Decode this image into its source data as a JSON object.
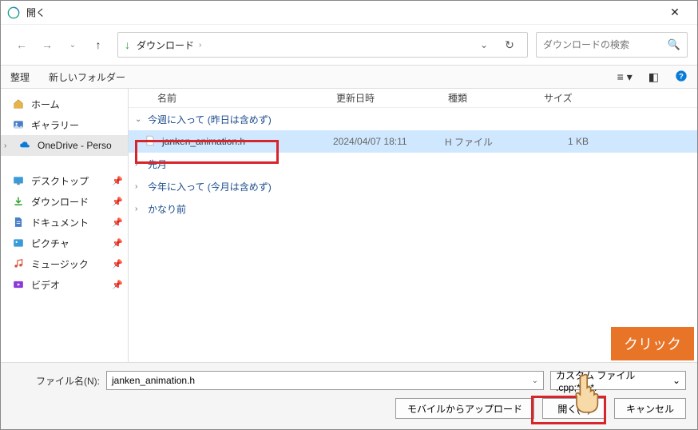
{
  "titlebar": {
    "title": "開く"
  },
  "nav": {
    "crumb": "ダウンロード",
    "search_placeholder": "ダウンロードの検索"
  },
  "toolbar": {
    "organize": "整理",
    "new_folder": "新しいフォルダー"
  },
  "sidebar": {
    "items": [
      {
        "label": "ホーム",
        "icon": "home"
      },
      {
        "label": "ギャラリー",
        "icon": "gallery"
      },
      {
        "label": "OneDrive - Perso",
        "icon": "onedrive",
        "expandable": true,
        "selected": true
      },
      {
        "label": "デスクトップ",
        "icon": "desktop",
        "pinned": true
      },
      {
        "label": "ダウンロード",
        "icon": "download",
        "pinned": true
      },
      {
        "label": "ドキュメント",
        "icon": "document",
        "pinned": true
      },
      {
        "label": "ピクチャ",
        "icon": "pictures",
        "pinned": true
      },
      {
        "label": "ミュージック",
        "icon": "music",
        "pinned": true
      },
      {
        "label": "ビデオ",
        "icon": "video",
        "pinned": true
      }
    ]
  },
  "columns": {
    "name": "名前",
    "date": "更新日時",
    "type": "種類",
    "size": "サイズ"
  },
  "groups": [
    {
      "label": "今週に入って (昨日は含めず)",
      "expanded": true,
      "files": [
        {
          "name": "janken_animation.h",
          "date": "2024/04/07 18:11",
          "type": "H ファイル",
          "size": "1 KB",
          "selected": true
        }
      ]
    },
    {
      "label": "先月",
      "expanded": false,
      "files": []
    },
    {
      "label": "今年に入って (今月は含めず)",
      "expanded": false,
      "files": []
    },
    {
      "label": "かなり前",
      "expanded": false,
      "files": []
    }
  ],
  "footer": {
    "filename_label": "ファイル名(N):",
    "filename_value": "janken_animation.h",
    "filter_value": "カスタム ファイル         .cpp;*.c;*.",
    "mobile_upload": "モバイルからアップロード",
    "open": "開く(O)",
    "cancel": "キャンセル"
  },
  "callout": {
    "text": "クリック"
  }
}
